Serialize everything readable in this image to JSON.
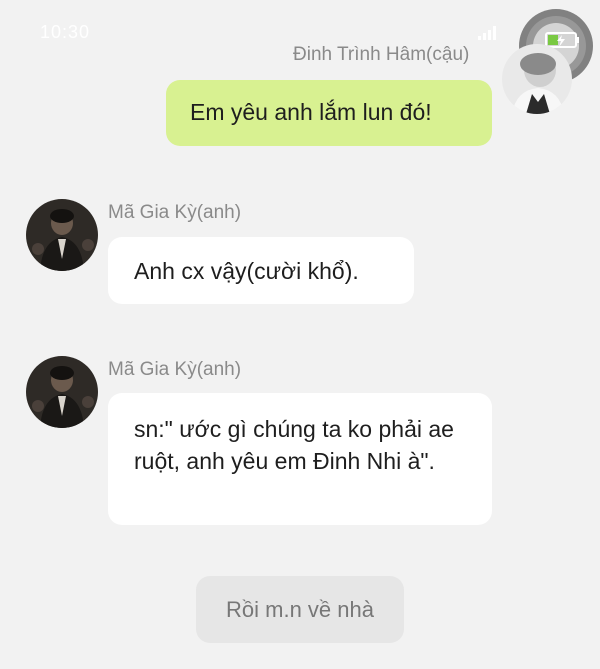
{
  "status_bar": {
    "time": "10:30"
  },
  "messages": [
    {
      "sender": "Đinh Trình Hâm(cậu)",
      "text": "Em yêu anh lắm lun đó!",
      "direction": "outgoing"
    },
    {
      "sender": "Mã Gia Kỳ(anh)",
      "text": "Anh cx vậy(cười khổ).",
      "direction": "incoming"
    },
    {
      "sender": "Mã Gia Kỳ(anh)",
      "text": "sn:\" ước gì chúng ta ko phải ae ruột, anh yêu em Đinh Nhi à\".",
      "direction": "incoming"
    }
  ],
  "system_message": "Rồi m.n về nhà",
  "colors": {
    "background": "#f2f2f2",
    "outgoing_bubble": "#d8f191",
    "incoming_bubble": "#ffffff",
    "system_pill": "#e6e6e6",
    "battery_accent": "#7ac943"
  },
  "icons": [
    "signal-icon",
    "battery-icon"
  ]
}
